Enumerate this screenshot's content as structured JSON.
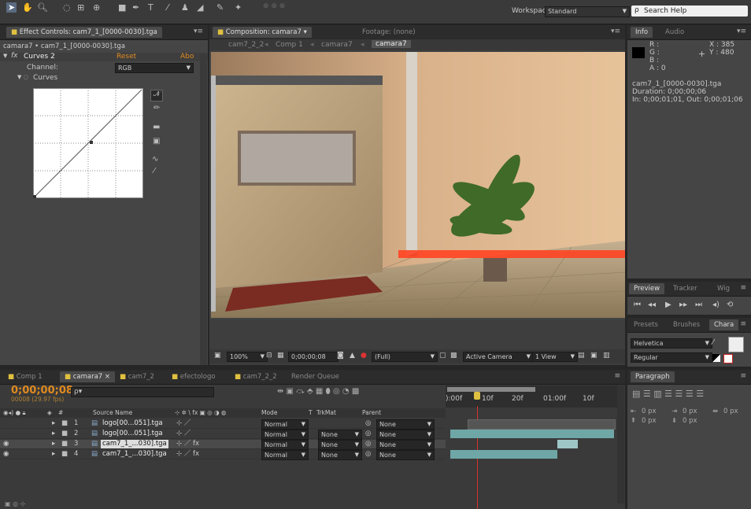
{
  "toolbar": {
    "tools": [
      "select-tool",
      "hand-tool",
      "zoom-tool",
      "orbit-tool",
      "pan-behind-tool",
      "rect-mask-tool",
      "pen-tool",
      "type-tool",
      "brush-tool",
      "clone-stamp-tool",
      "eraser-tool",
      "roto-brush-tool",
      "puppet-pin-tool"
    ],
    "workspace_label": "Workspace:",
    "workspace_value": "Standard",
    "search_placeholder": "Search Help"
  },
  "effect_controls": {
    "tab_label": "Effect Controls: cam7_1_[0000-0030].tga",
    "subtitle": "camara7 • cam7_1_[0000-0030].tga",
    "effect_name": "Curves 2",
    "reset_label": "Reset",
    "about_label": "Abo",
    "channel_label": "Channel:",
    "channel_value": "RGB",
    "curves_label": "Curves"
  },
  "composition": {
    "tab_label": "Composition: camara7",
    "footage_tab": "Footage: (none)",
    "breadcrumbs": [
      "cam7_2_2",
      "Comp 1",
      "camara7",
      "camara7"
    ],
    "zoom": "100%",
    "timecode": "0;00;00;08",
    "resolution": "(Full)",
    "camera": "Active Camera",
    "view": "1 View"
  },
  "info": {
    "tab_info": "Info",
    "tab_audio": "Audio",
    "r": "R :",
    "g": "G :",
    "b": "B :",
    "a": "A : 0",
    "x": "X : 385",
    "y": "Y : 480",
    "file": "cam7_1_[0000-0030].tga",
    "duration": "Duration: 0;00;00;06",
    "inout": "In: 0;00;01;01, Out: 0;00;01;06"
  },
  "preview": {
    "tabs": [
      "Preview",
      "Tracker",
      "Wig"
    ]
  },
  "character": {
    "tabs": [
      "Presets",
      "Brushes",
      "Chara"
    ],
    "font": "Helvetica",
    "style": "Regular"
  },
  "paragraph": {
    "tab": "Paragraph",
    "indent_left": "0 px",
    "indent_right": "0 px",
    "indent_first": "0 px",
    "space_before": "0 px",
    "space_after": "0 px"
  },
  "timeline": {
    "tabs": [
      "Comp 1",
      "camara7",
      "cam7_2",
      "efectologo",
      "cam7_2_2",
      "Render Queue"
    ],
    "timecode": "0;00;00;08",
    "fps": "00008 (29.97 fps)",
    "search_placeholder": "ρ▾",
    "columns": {
      "num": "#",
      "source": "Source Name",
      "mode": "Mode",
      "t": "T",
      "trkmat": "TrkMat",
      "parent": "Parent"
    },
    "ruler": [
      "):00f",
      "10f",
      "20f",
      "01:00f",
      "10f"
    ],
    "layers": [
      {
        "num": "1",
        "name": "logo[00...051].tga",
        "mode": "Normal",
        "trkmat": "",
        "parent": "None"
      },
      {
        "num": "2",
        "name": "logo[00...051].tga",
        "mode": "Normal",
        "trkmat": "None",
        "parent": "None"
      },
      {
        "num": "3",
        "name": "cam7_1_...030].tga",
        "mode": "Normal",
        "trkmat": "None",
        "parent": "None"
      },
      {
        "num": "4",
        "name": "cam7_1_...030].tga",
        "mode": "Normal",
        "trkmat": "None",
        "parent": "None"
      }
    ]
  },
  "colors": {
    "accent_orange": "#e08a1e",
    "playhead": "#d8332a",
    "bar_teal": "#6fa6a6",
    "comp_tab_yellow": "#e0c040"
  }
}
